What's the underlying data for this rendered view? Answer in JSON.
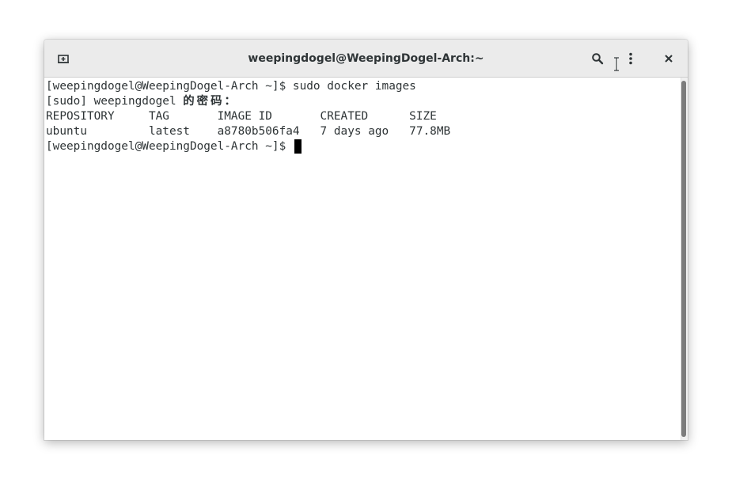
{
  "window": {
    "title": "weepingdogel@WeepingDogel-Arch:~"
  },
  "header": {
    "icons": {
      "new_tab": "new-tab-icon",
      "search": "search-icon",
      "menu": "kebab-menu-icon",
      "close": "close-icon"
    }
  },
  "terminal": {
    "lines": [
      {
        "text": "[weepingdogel@WeepingDogel-Arch ~]$ sudo docker images"
      },
      {
        "prefix": "[sudo] weepingdogel ",
        "cjk": "的密码："
      },
      {
        "text": "REPOSITORY     TAG       IMAGE ID       CREATED      SIZE"
      },
      {
        "text": "ubuntu         latest    a8780b506fa4   7 days ago   77.8MB"
      },
      {
        "text": "[weepingdogel@WeepingDogel-Arch ~]$ "
      }
    ]
  },
  "colors": {
    "headerbar": "#ebebeb",
    "text": "#2e3436",
    "cursor": "#000000"
  }
}
